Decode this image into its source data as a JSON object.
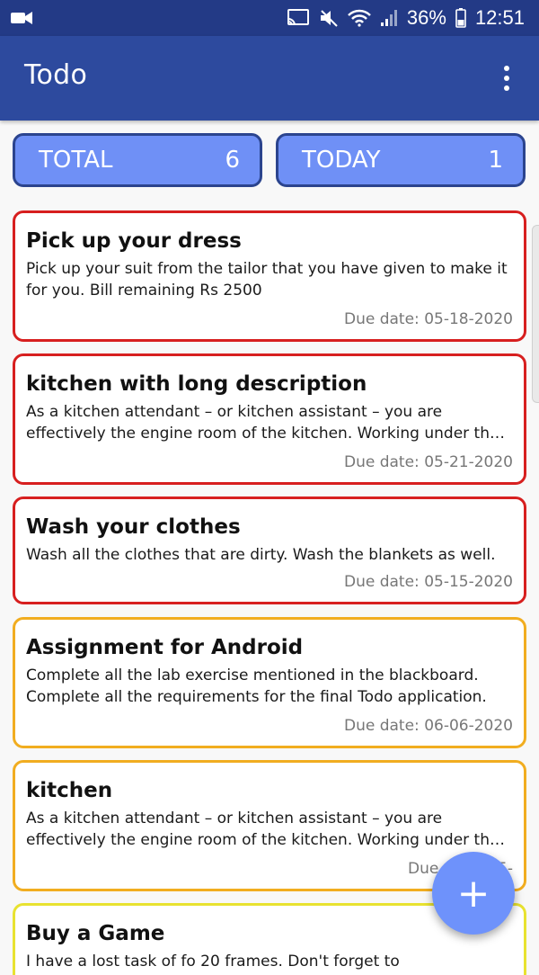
{
  "status_bar": {
    "battery": "36%",
    "time": "12:51",
    "icons": [
      "video-camera-icon",
      "cast-icon",
      "mute-icon",
      "wifi-icon",
      "signal-icon",
      "battery-icon"
    ]
  },
  "app_bar": {
    "title": "Todo",
    "menu_icon": "more-vert-icon"
  },
  "counters": {
    "total": {
      "label": "TOTAL",
      "value": "6"
    },
    "today": {
      "label": "TODAY",
      "value": "1"
    }
  },
  "todos": [
    {
      "title": "Pick up your dress",
      "description": "Pick up your suit from the tailor that you have given to make it for you. Bill remaining Rs 2500",
      "due": "Due date: 05-18-2020",
      "priority_color": "#d71f1f"
    },
    {
      "title": "kitchen with long description",
      "description": "As a kitchen attendant – or kitchen assistant – you are effectively the engine room of the kitchen. Working under the chef",
      "due": "Due date: 05-21-2020",
      "priority_color": "#d71f1f"
    },
    {
      "title": "Wash your clothes",
      "description": "Wash all the clothes that are dirty. Wash the blankets as well.",
      "due": "Due date: 05-15-2020",
      "priority_color": "#d71f1f"
    },
    {
      "title": "Assignment for Android",
      "description": "Complete all the lab exercise mentioned in the blackboard. Complete all the requirements for the final Todo application.",
      "due": "Due date: 06-06-2020",
      "priority_color": "#f1ad20"
    },
    {
      "title": "kitchen",
      "description": "As a kitchen attendant – or kitchen assistant – you are effectively the engine room of the kitchen. Working under the chef",
      "due": "Due date: 05-",
      "priority_color": "#f1ad20"
    },
    {
      "title": "Buy a Game",
      "description": "I have a lost task of fo 20 frames. Don't forget to",
      "due": "",
      "priority_color": "#e8e230"
    }
  ],
  "fab": {
    "label": "+",
    "icon": "add-icon"
  },
  "colors": {
    "status_bar": "#233a86",
    "app_bar": "#2d4a9e",
    "counter_fill": "#6f90f6",
    "counter_border": "#2b448e",
    "fab": "#6e92fb"
  }
}
